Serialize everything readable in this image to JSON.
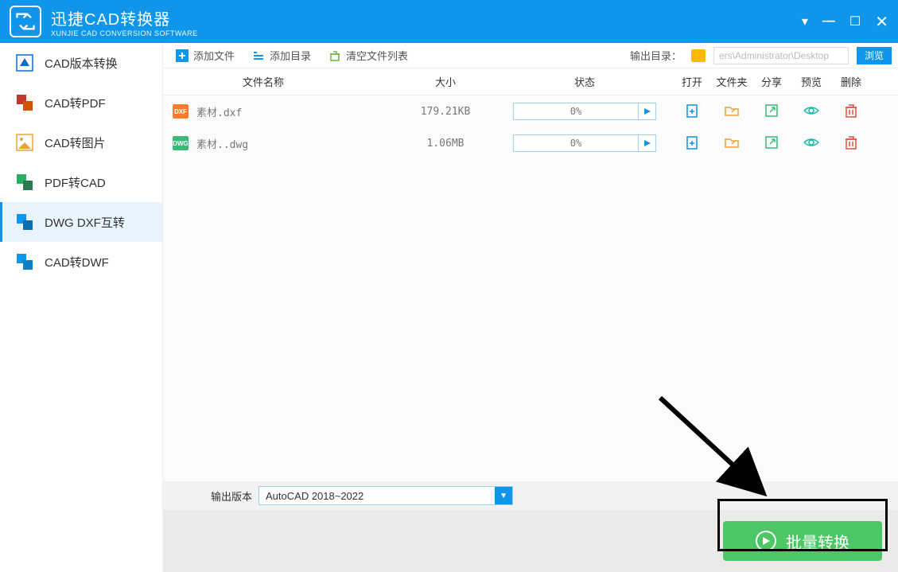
{
  "title": {
    "main": "迅捷CAD转换器",
    "sub": "XUNJIE CAD CONVERSION SOFTWARE"
  },
  "sidebar": {
    "items": [
      {
        "label": "CAD版本转换"
      },
      {
        "label": "CAD转PDF"
      },
      {
        "label": "CAD转图片"
      },
      {
        "label": "PDF转CAD"
      },
      {
        "label": "DWG DXF互转"
      },
      {
        "label": "CAD转DWF"
      }
    ],
    "active_index": 4
  },
  "toolbar": {
    "add_file": "添加文件",
    "add_dir": "添加目录",
    "clear_list": "清空文件列表",
    "output_label": "输出目录：",
    "output_path": "ers\\Administrator\\Desktop",
    "browse": "浏览"
  },
  "columns": {
    "name": "文件名称",
    "size": "大小",
    "status": "状态",
    "open": "打开",
    "folder": "文件夹",
    "share": "分享",
    "preview": "预览",
    "delete": "删除"
  },
  "files": [
    {
      "type": "dxf",
      "badge": "DXF",
      "name": "素材.dxf",
      "size": "179.21KB",
      "progress": "0%"
    },
    {
      "type": "dwg",
      "badge": "DWG",
      "name": "素材..dwg",
      "size": "1.06MB",
      "progress": "0%"
    }
  ],
  "output_version": {
    "label": "输出版本",
    "value": "AutoCAD 2018~2022"
  },
  "convert_button": "批量转换"
}
